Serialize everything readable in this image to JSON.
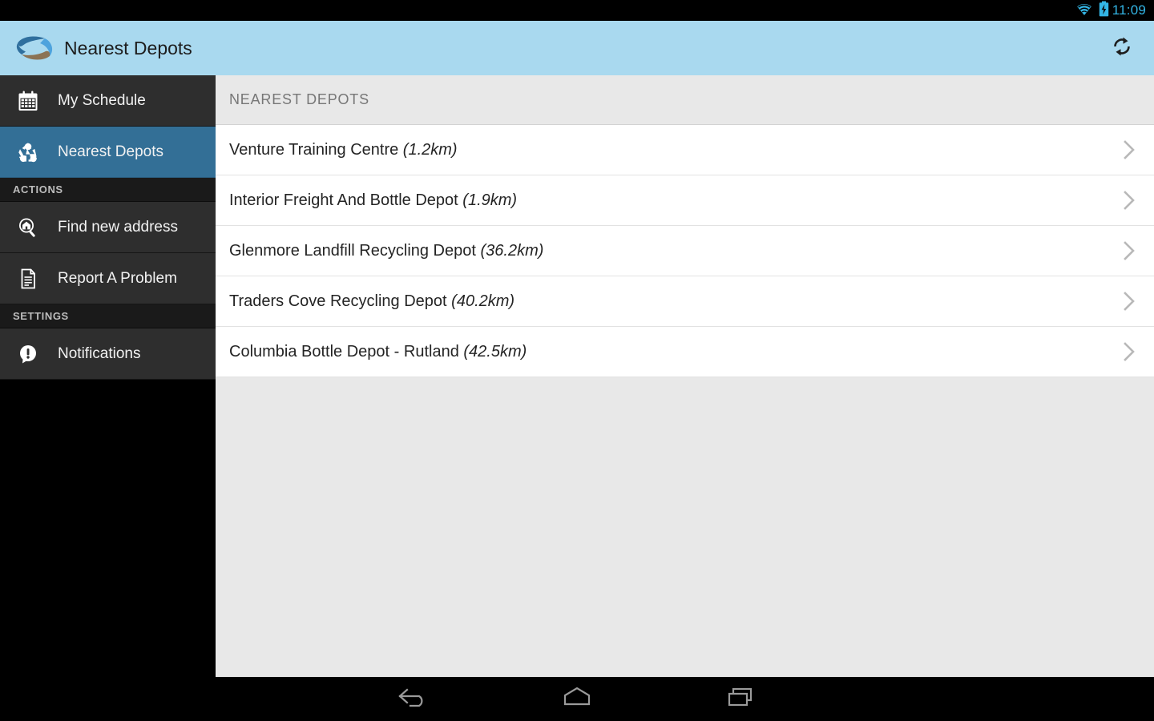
{
  "statusbar": {
    "time": "11:09",
    "icons": [
      "wifi-icon",
      "battery-charging-icon"
    ]
  },
  "actionbar": {
    "logo": "recycle-swoosh-logo",
    "title": "Nearest Depots",
    "refresh": "refresh-icon"
  },
  "sidebar": {
    "items": [
      {
        "type": "item",
        "icon": "calendar-icon",
        "label": "My Schedule",
        "selected": false
      },
      {
        "type": "item",
        "icon": "recycle-icon",
        "label": "Nearest Depots",
        "selected": true
      },
      {
        "type": "section",
        "label": "ACTIONS"
      },
      {
        "type": "item",
        "icon": "search-home-icon",
        "label": "Find new address",
        "selected": false
      },
      {
        "type": "item",
        "icon": "document-icon",
        "label": "Report A Problem",
        "selected": false
      },
      {
        "type": "section",
        "label": "SETTINGS"
      },
      {
        "type": "item",
        "icon": "alert-bubble-icon",
        "label": "Notifications",
        "selected": false
      }
    ]
  },
  "content": {
    "list_header": "NEAREST DEPOTS",
    "rows": [
      {
        "name": "Venture Training Centre ",
        "distance": "(1.2km)"
      },
      {
        "name": "Interior Freight And Bottle Depot ",
        "distance": "(1.9km)"
      },
      {
        "name": "Glenmore Landfill Recycling Depot ",
        "distance": "(36.2km)"
      },
      {
        "name": "Traders Cove Recycling Depot ",
        "distance": "(40.2km)"
      },
      {
        "name": "Columbia Bottle Depot - Rutland ",
        "distance": "(42.5km)"
      }
    ],
    "chevron": "chevron-right-icon"
  },
  "navbar": {
    "buttons": [
      {
        "name": "back-icon"
      },
      {
        "name": "home-icon"
      },
      {
        "name": "recents-icon"
      }
    ]
  },
  "colors": {
    "accent_blue": "#a9d9ef",
    "selected_blue": "#336f96",
    "status_time": "#33b5e5",
    "sidebar_item": "#2e2e2e",
    "sidebar_section": "#1a1a1a",
    "content_bg": "#e8e8e8"
  }
}
